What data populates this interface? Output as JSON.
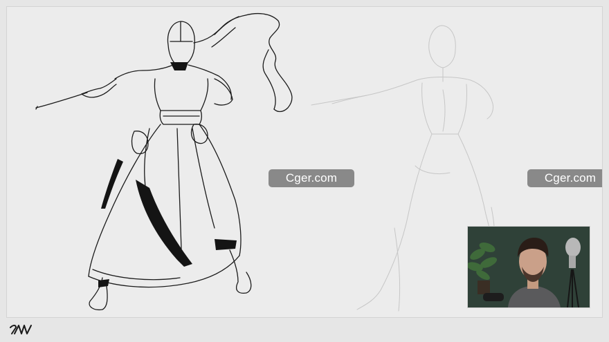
{
  "watermarks": [
    {
      "text": "Cger.com"
    },
    {
      "text": "Cger.com"
    }
  ],
  "logo": {
    "icon": "artist-signature-logo"
  },
  "webcam": {
    "icon": "webcam-feed"
  },
  "colors": {
    "canvas": "#ececec",
    "background": "#e6e6e6",
    "watermark_bg": "#787878",
    "watermark_text": "#ffffff",
    "ink": "#111111",
    "sketch": "#c8c8c8"
  }
}
